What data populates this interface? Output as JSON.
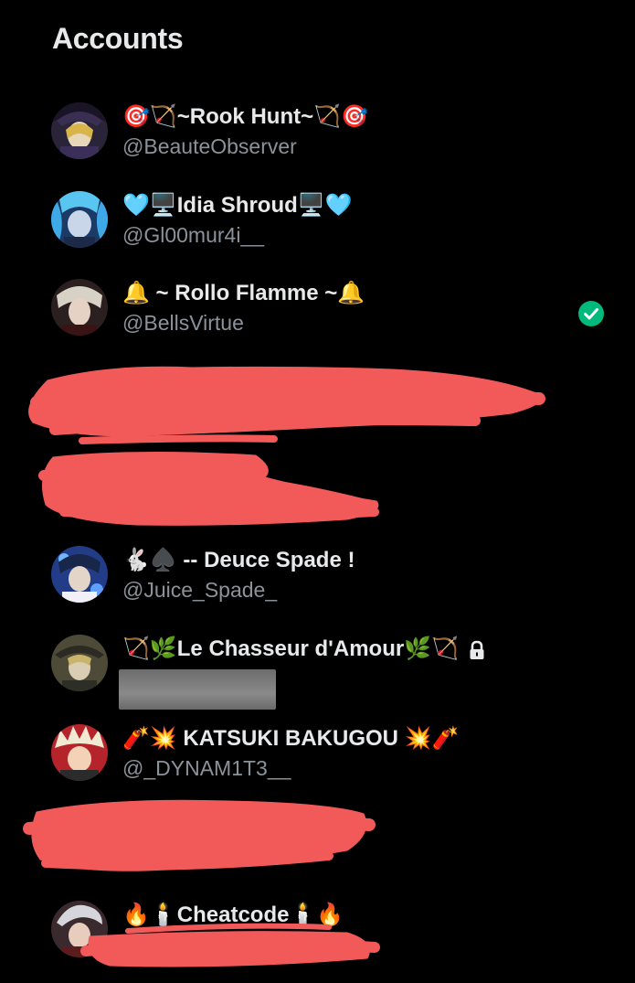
{
  "header": {
    "title": "Accounts"
  },
  "accounts": [
    {
      "name": "🎯🏹~Rook Hunt~🏹🎯",
      "handle": "@BeauteObserver",
      "avatar": "avatar-rook"
    },
    {
      "name": "🩵🖥️Idia Shroud🖥️🩵",
      "handle": "@Gl00mur4i__",
      "avatar": "avatar-idia"
    },
    {
      "name": "🔔 ~ Rollo Flamme ~🔔",
      "handle": "@BellsVirtue",
      "avatar": "avatar-rollo",
      "active": true
    },
    {
      "name": "🐇♠️ -- Deuce Spade !",
      "handle": "@Juice_Spade_",
      "avatar": "avatar-deuce"
    },
    {
      "name": "🏹🌿Le Chasseur d'Amour🌿🏹",
      "handle": "",
      "avatar": "avatar-chasseur",
      "protected": true
    },
    {
      "name": "🧨💥 KATSUKI BAKUGOU 💥🧨",
      "handle": "@_DYNAM1T3__",
      "avatar": "avatar-bakugou"
    },
    {
      "name": "🔥🕯️Cheatcode🕯️🔥",
      "handle": "",
      "avatar": "avatar-cheatcode"
    }
  ],
  "icons": {
    "active_check": "check-circle-icon",
    "protected": "lock-icon"
  },
  "colors": {
    "background": "#000000",
    "primary_text": "#e7e9ea",
    "secondary_text": "#8b9299",
    "active_check": "#00ba7c",
    "redaction": "#f25a5a"
  }
}
